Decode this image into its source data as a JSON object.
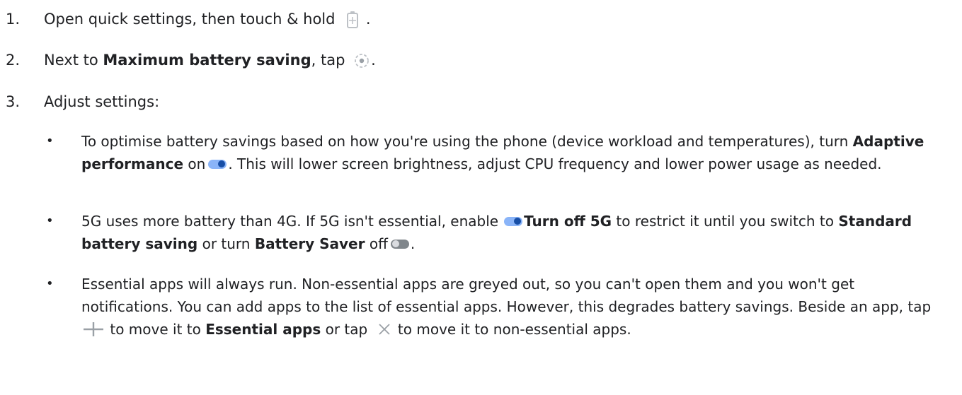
{
  "steps": [
    {
      "num": "1.",
      "pre": "Open quick settings, then touch & hold",
      "post": ".",
      "icon": "battery-icon"
    },
    {
      "num": "2.",
      "pre": "Next to ",
      "bold": "Maximum battery saving",
      "mid": ", tap",
      "post": ".",
      "icon": "gear-icon"
    },
    {
      "num": "3.",
      "text": "Adjust settings:"
    }
  ],
  "bullets": {
    "b1": {
      "pre": "To optimise battery savings based on how you're using the phone (device workload and temperatures), turn ",
      "bold": "Adaptive performance",
      "mid": " on",
      "post": ". This will lower screen brightness, adjust CPU frequency and lower power usage as needed."
    },
    "b2": {
      "pre": "5G uses more battery than 4G. If 5G isn't essential, enable",
      "bold1": "Turn off 5G",
      "mid1": " to restrict it until you switch to ",
      "bold2": "Standard battery saving",
      "mid2": " or turn ",
      "bold3": "Battery Saver",
      "mid3": " off",
      "post": "."
    },
    "b3": {
      "pre": "Essential apps will always run. Non-essential apps are greyed out, so you can't open them and you won't get notifications. You can add apps to the list of essential apps. However, this degrades battery savings. Beside an app, tap",
      "mid1": " to move it to ",
      "bold": "Essential apps",
      "mid2": " or tap",
      "post": " to move it to non-essential apps."
    }
  },
  "icons": {
    "battery": "battery-saver-icon",
    "gear": "settings-gear-icon",
    "toggle_on": "toggle-on-icon",
    "toggle_off": "toggle-off-icon",
    "plus": "plus-icon",
    "close": "close-icon"
  },
  "colors": {
    "text": "#202124",
    "toggle_on_track": "#8ab4f8",
    "toggle_on_thumb": "#174ea6",
    "toggle_off_track": "#80868b",
    "icon_grey": "#9aa0a6"
  }
}
